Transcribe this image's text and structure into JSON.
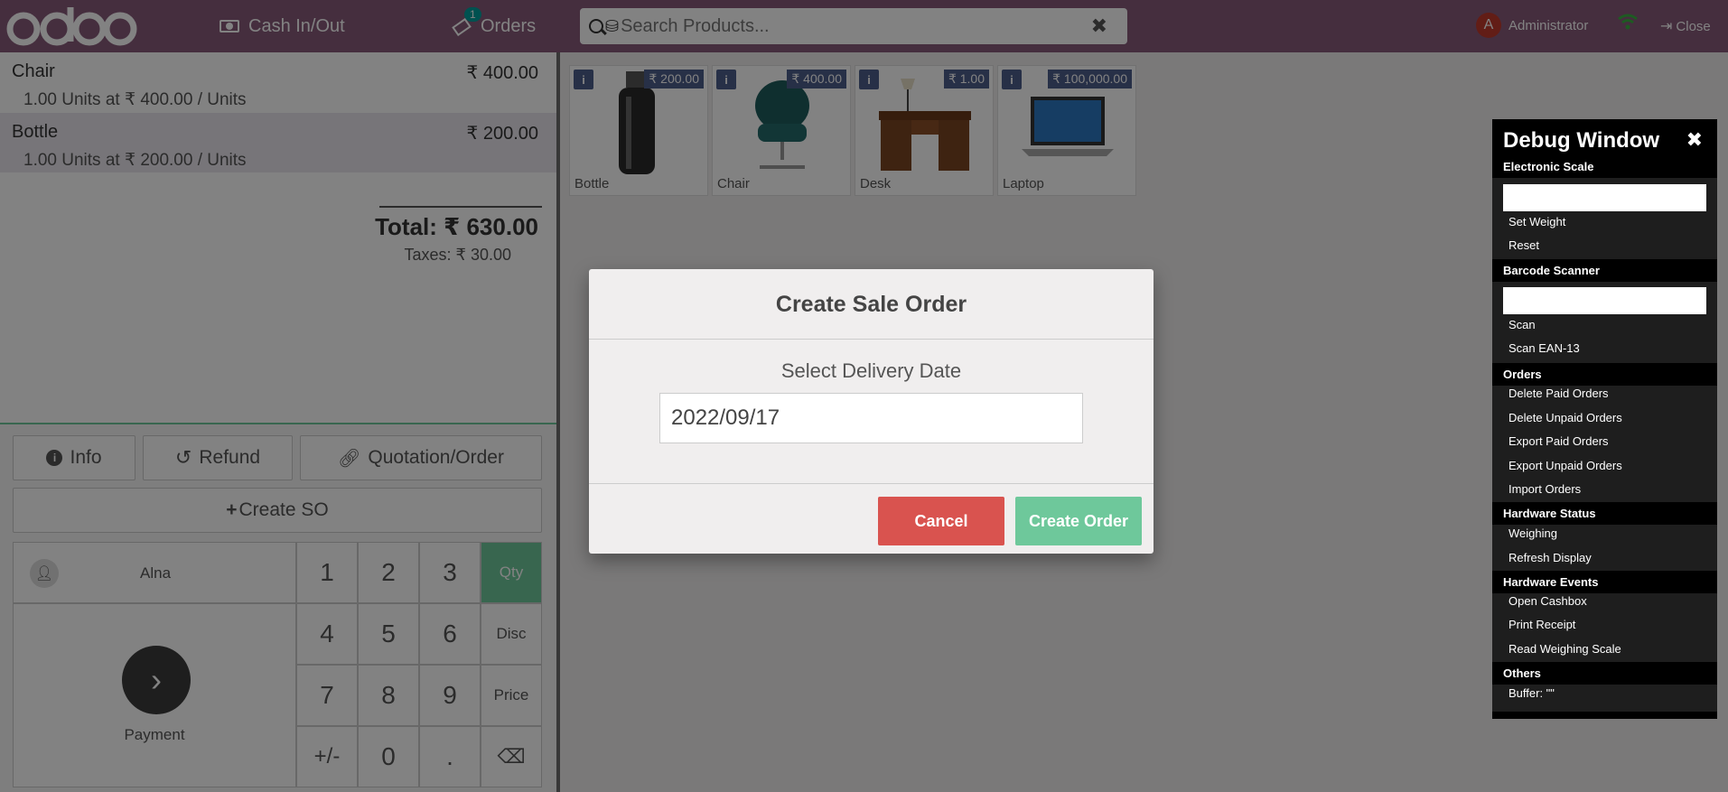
{
  "topbar": {
    "cash_label": "Cash In/Out",
    "orders_label": "Orders",
    "orders_count": "1",
    "search_placeholder": "Search Products...",
    "user_initial": "A",
    "user_name": "Administrator",
    "close_label": "Close"
  },
  "order": {
    "lines": [
      {
        "name": "Chair",
        "price": "₹ 400.00",
        "qty": "1.00",
        "info": "Units at ₹ 400.00 / Units"
      },
      {
        "name": "Bottle",
        "price": "₹ 200.00",
        "qty": "1.00",
        "info": "Units at ₹ 200.00 / Units"
      }
    ],
    "total": "Total: ₹ 630.00",
    "taxes": "Taxes: ₹ 30.00"
  },
  "controls": {
    "info": "Info",
    "refund": "Refund",
    "quotation": "Quotation/Order",
    "create_so": "Create SO",
    "customer": "Alna",
    "payment": "Payment",
    "keys": [
      "1",
      "2",
      "3",
      "4",
      "5",
      "6",
      "7",
      "8",
      "9",
      "+/-",
      "0",
      "."
    ],
    "mode_qty": "Qty",
    "mode_disc": "Disc",
    "mode_price": "Price"
  },
  "products": [
    {
      "name": "Bottle",
      "price": "₹ 200.00"
    },
    {
      "name": "Chair",
      "price": "₹ 400.00"
    },
    {
      "name": "Desk",
      "price": "₹ 1.00"
    },
    {
      "name": "Laptop",
      "price": "₹ 100,000.00"
    }
  ],
  "modal": {
    "title": "Create Sale Order",
    "subtitle": "Select Delivery Date",
    "date": "2022/09/17",
    "cancel": "Cancel",
    "create": "Create Order",
    "cancel_color": "#d9534f",
    "create_color": "#6ec89b"
  },
  "debug": {
    "title": "Debug Window",
    "sections": {
      "scale": "Electronic Scale",
      "barcode": "Barcode Scanner",
      "orders": "Orders",
      "hw_status": "Hardware Status",
      "hw_events": "Hardware Events",
      "others": "Others"
    },
    "items": {
      "set_weight": "Set Weight",
      "reset": "Reset",
      "scan": "Scan",
      "scan_ean": "Scan EAN-13",
      "delete_paid": "Delete Paid Orders",
      "delete_unpaid": "Delete Unpaid Orders",
      "export_paid": "Export Paid Orders",
      "export_unpaid": "Export Unpaid Orders",
      "import": "Import Orders",
      "weighing": "Weighing",
      "refresh": "Refresh Display",
      "open_cashbox": "Open Cashbox",
      "print_receipt": "Print Receipt",
      "read_scale": "Read Weighing Scale",
      "buffer": "Buffer: \"\""
    }
  }
}
